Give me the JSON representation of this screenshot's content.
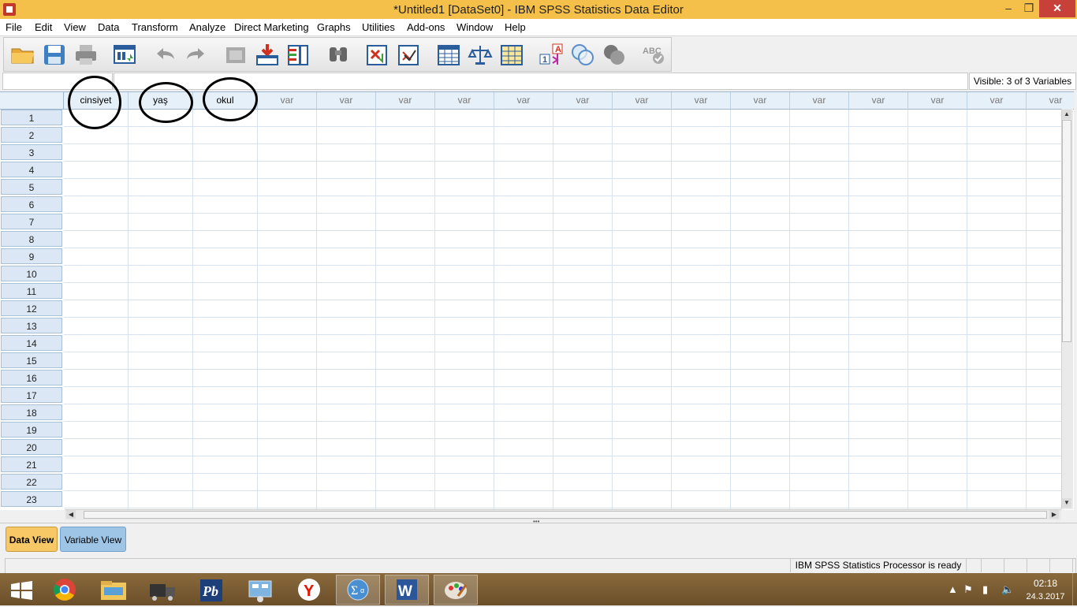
{
  "window": {
    "title": "*Untitled1 [DataSet0] - IBM SPSS Statistics Data Editor",
    "controls": [
      "minimize",
      "maximize",
      "close"
    ]
  },
  "menu": [
    "File",
    "Edit",
    "View",
    "Data",
    "Transform",
    "Analyze",
    "Direct Marketing",
    "Graphs",
    "Utilities",
    "Add-ons",
    "Window",
    "Help"
  ],
  "toolbar": {
    "icons": [
      "open-folder-icon",
      "save-icon",
      "print-icon",
      "recall-dialog-icon",
      "undo-icon",
      "redo-icon",
      "goto-case-icon",
      "goto-variable-icon",
      "variables-icon",
      "find-icon",
      "insert-cases-icon",
      "insert-variable-icon",
      "split-file-icon",
      "weight-cases-icon",
      "select-cases-icon",
      "value-labels-icon",
      "use-variable-sets-icon",
      "show-all-variables-icon",
      "spell-check-icon"
    ]
  },
  "cell_editor": {
    "reference": "",
    "value": "",
    "visible_info": "Visible: 3 of 3 Variables"
  },
  "grid": {
    "columns": [
      "cinsiyet",
      "yaş",
      "okul",
      "var",
      "var",
      "var",
      "var",
      "var",
      "var",
      "var",
      "var",
      "var",
      "var",
      "var",
      "var",
      "var",
      "var"
    ],
    "named_columns": 3,
    "rows": [
      "1",
      "2",
      "3",
      "4",
      "5",
      "6",
      "7",
      "8",
      "9",
      "10",
      "11",
      "12",
      "13",
      "14",
      "15",
      "16",
      "17",
      "18",
      "19",
      "20",
      "21",
      "22",
      "23"
    ]
  },
  "tabs": {
    "data_view": "Data View",
    "variable_view": "Variable View",
    "active": "data_view"
  },
  "status": {
    "processor": "IBM SPSS Statistics Processor is ready"
  },
  "taskbar": {
    "apps": [
      "windows-start-icon",
      "chrome-icon",
      "file-explorer-icon",
      "truck-app-icon",
      "powerbuilder-icon",
      "network-app-icon",
      "yandex-icon",
      "spss-icon",
      "word-icon",
      "paint-icon"
    ],
    "active_app": "spss-icon",
    "time": "02:18",
    "date": "24.3.2017"
  },
  "colors": {
    "titlebar": "#f5c04a",
    "active_tab": "#f7c865",
    "inactive_tab": "#9ec4e6",
    "header_bg": "#e6f0f9",
    "taskbar": "#7a5c33"
  }
}
